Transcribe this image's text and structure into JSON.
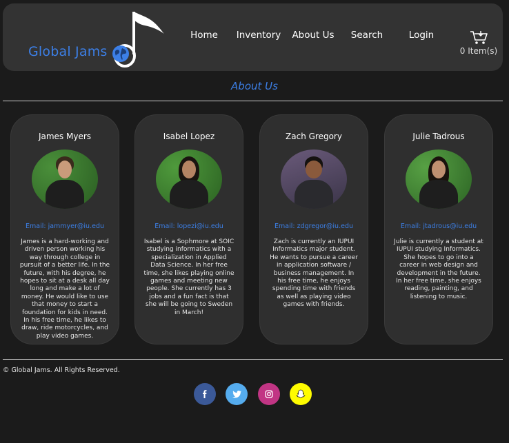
{
  "brand": {
    "name": "Global Jams",
    "accent": "#3c7fe6"
  },
  "nav": [
    {
      "label": "Home"
    },
    {
      "label": "Inventory"
    },
    {
      "label": "About Us"
    },
    {
      "label": "Search"
    },
    {
      "label": "Login"
    }
  ],
  "cart": {
    "label": "0 Item(s)",
    "icon": "cart-icon"
  },
  "page": {
    "title": "About Us"
  },
  "team": [
    {
      "name": "James Myers",
      "email": "Email: jammyer@iu.edu",
      "bio": "James is a hard-working and driven person working his way through college in pursuit of a better life. In the future, with his degree, he hopes to sit at a desk all day long and make a lot of money. He would like to use that money to start a foundation for kids in need. In his free time, he likes to draw, ride motorcycles, and play video games."
    },
    {
      "name": "Isabel Lopez",
      "email": "Email: lopezi@iu.edu",
      "bio": "Isabel is a Sophmore at SOIC studying informatics with a specialization in Applied Data Science. In her free time, she likes playing online games and meeting new people. She currently has 3 jobs and a fun fact is that she will be going to Sweden in March!"
    },
    {
      "name": "Zach Gregory",
      "email": "Email: zdgregor@iu.edu",
      "bio": "Zach is currently an IUPUI Informatics major student. He wants to pursue a career in application software / business management. In his free time, he enjoys spending time with friends as well as playing video games with friends."
    },
    {
      "name": "Julie Tadrous",
      "email": "Email: jtadrous@iu.edu",
      "bio": "Julie is currently a student at IUPUI studying Informatics. She hopes to go into a career in web design and development in the future. In her free time, she enjoys reading, painting, and listening to music."
    }
  ],
  "footer": {
    "copyright": "© Global Jams. All Rights Reserved.",
    "social": [
      {
        "icon": "facebook-icon",
        "glyph": "f",
        "color": "#3b5998"
      },
      {
        "icon": "twitter-icon",
        "glyph": "t",
        "color": "#55acee"
      },
      {
        "icon": "instagram-icon",
        "glyph": "◎",
        "color": "#c13584"
      },
      {
        "icon": "snapchat-icon",
        "glyph": "☺",
        "color": "#fffc00"
      }
    ]
  }
}
